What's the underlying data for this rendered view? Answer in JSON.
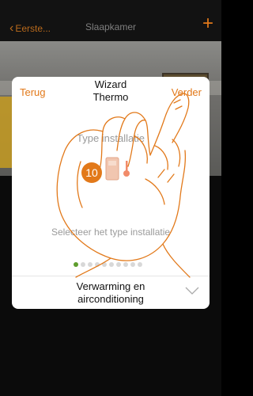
{
  "topbar": {
    "back_label": "Eerste...",
    "title": "Slaapkamer",
    "add_icon": "plus-icon"
  },
  "dialog": {
    "back_label": "Terug",
    "title": "Wizard\nThermo",
    "title_line1": "Wizard",
    "title_line2": "Thermo",
    "next_label": "Verder",
    "type_label": "Type installatie",
    "device_icon": "thermo-device-icon",
    "select_label": "Selecteer het type installatie",
    "pagination": {
      "total": 10,
      "active_index": 0
    },
    "dropdown": {
      "value_line1": "Verwarming en",
      "value_line2": "airconditioning"
    }
  },
  "overlay": {
    "step_number": "10"
  },
  "colors": {
    "accent": "#e2791a",
    "active_dot": "#5e9d2d"
  }
}
